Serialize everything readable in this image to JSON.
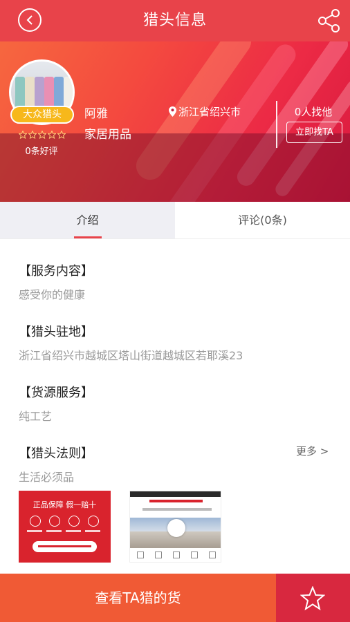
{
  "header": {
    "title": "猎头信息",
    "back_icon": "back-arrow-icon",
    "share_icon": "share-icon"
  },
  "profile": {
    "badge": "大众猎头",
    "stars": 5,
    "rating_fill": 0,
    "reviews_count": "0条好评",
    "name": "阿雅",
    "category": "家居用品",
    "location": "浙江省绍兴市",
    "finders": "0人找他",
    "find_button": "立即找TA"
  },
  "tabs": [
    {
      "label": "介绍",
      "active": true
    },
    {
      "label": "评论(0条)",
      "active": false
    }
  ],
  "sections": {
    "service": {
      "title": "【服务内容】",
      "text": "感受你的健康"
    },
    "base": {
      "title": "【猎头驻地】",
      "text": "浙江省绍兴市越城区塔山街道越城区若耶溪23"
    },
    "supply": {
      "title": "【货源服务】",
      "text": "纯工艺"
    },
    "rules": {
      "title": "【猎头法则】",
      "text": "生活必须品",
      "more": "更多 >"
    }
  },
  "thumbnails": [
    {
      "caption": "正品保障 假一赔十"
    },
    {
      "caption": "cotton-field-image"
    }
  ],
  "bottom": {
    "primary": "查看TA猎的货",
    "favorite_icon": "star-outline-icon"
  },
  "colors": {
    "brand_red": "#e8434a",
    "orange": "#f05a35",
    "badge_yellow": "#f7b81b",
    "muted_text": "#999999"
  }
}
